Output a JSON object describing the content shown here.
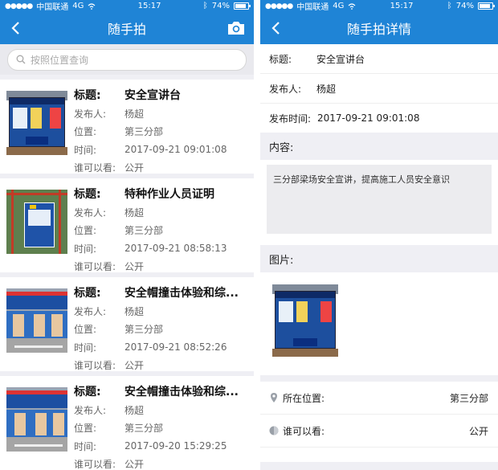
{
  "status": {
    "carrier": "中国联通",
    "network": "4G",
    "time": "15:17",
    "battery": "74%",
    "battery_level": 0.74
  },
  "list_screen": {
    "title": "随手拍",
    "search_placeholder": "按照位置查询",
    "labels": {
      "title": "标题:",
      "publisher": "发布人:",
      "location": "位置:",
      "time": "时间:",
      "visibility": "谁可以看:"
    },
    "items": [
      {
        "title": "安全宣讲台",
        "publisher": "杨超",
        "location": "第三分部",
        "time": "2017-09-21 09:01:08",
        "visibility": "公开"
      },
      {
        "title": "特种作业人员证明",
        "publisher": "杨超",
        "location": "第三分部",
        "time": "2017-09-21 08:58:13",
        "visibility": "公开"
      },
      {
        "title": "安全帽撞击体验和综...",
        "publisher": "杨超",
        "location": "第三分部",
        "time": "2017-09-21 08:52:26",
        "visibility": "公开"
      },
      {
        "title": "安全帽撞击体验和综...",
        "publisher": "杨超",
        "location": "第三分部",
        "time": "2017-09-20 15:29:25",
        "visibility": "公开"
      }
    ]
  },
  "detail_screen": {
    "title": "随手拍详情",
    "title_label": "标题:",
    "title_value": "安全宣讲台",
    "publisher_label": "发布人:",
    "publisher_value": "杨超",
    "time_label": "发布时间:",
    "time_value": "2017-09-21 09:01:08",
    "content_label": "内容:",
    "content_text": "三分部梁场安全宣讲，提高施工人员安全意识",
    "images_label": "图片:",
    "location_label": "所在位置:",
    "location_value": "第三分部",
    "visibility_label": "谁可以看:",
    "visibility_value": "公开"
  },
  "colors": {
    "accent": "#1f84d6",
    "background": "#efeff4"
  },
  "icons": [
    "back-chevron-icon",
    "camera-icon",
    "search-icon",
    "location-pin-icon",
    "visibility-icon",
    "wifi-icon",
    "bluetooth-icon"
  ]
}
